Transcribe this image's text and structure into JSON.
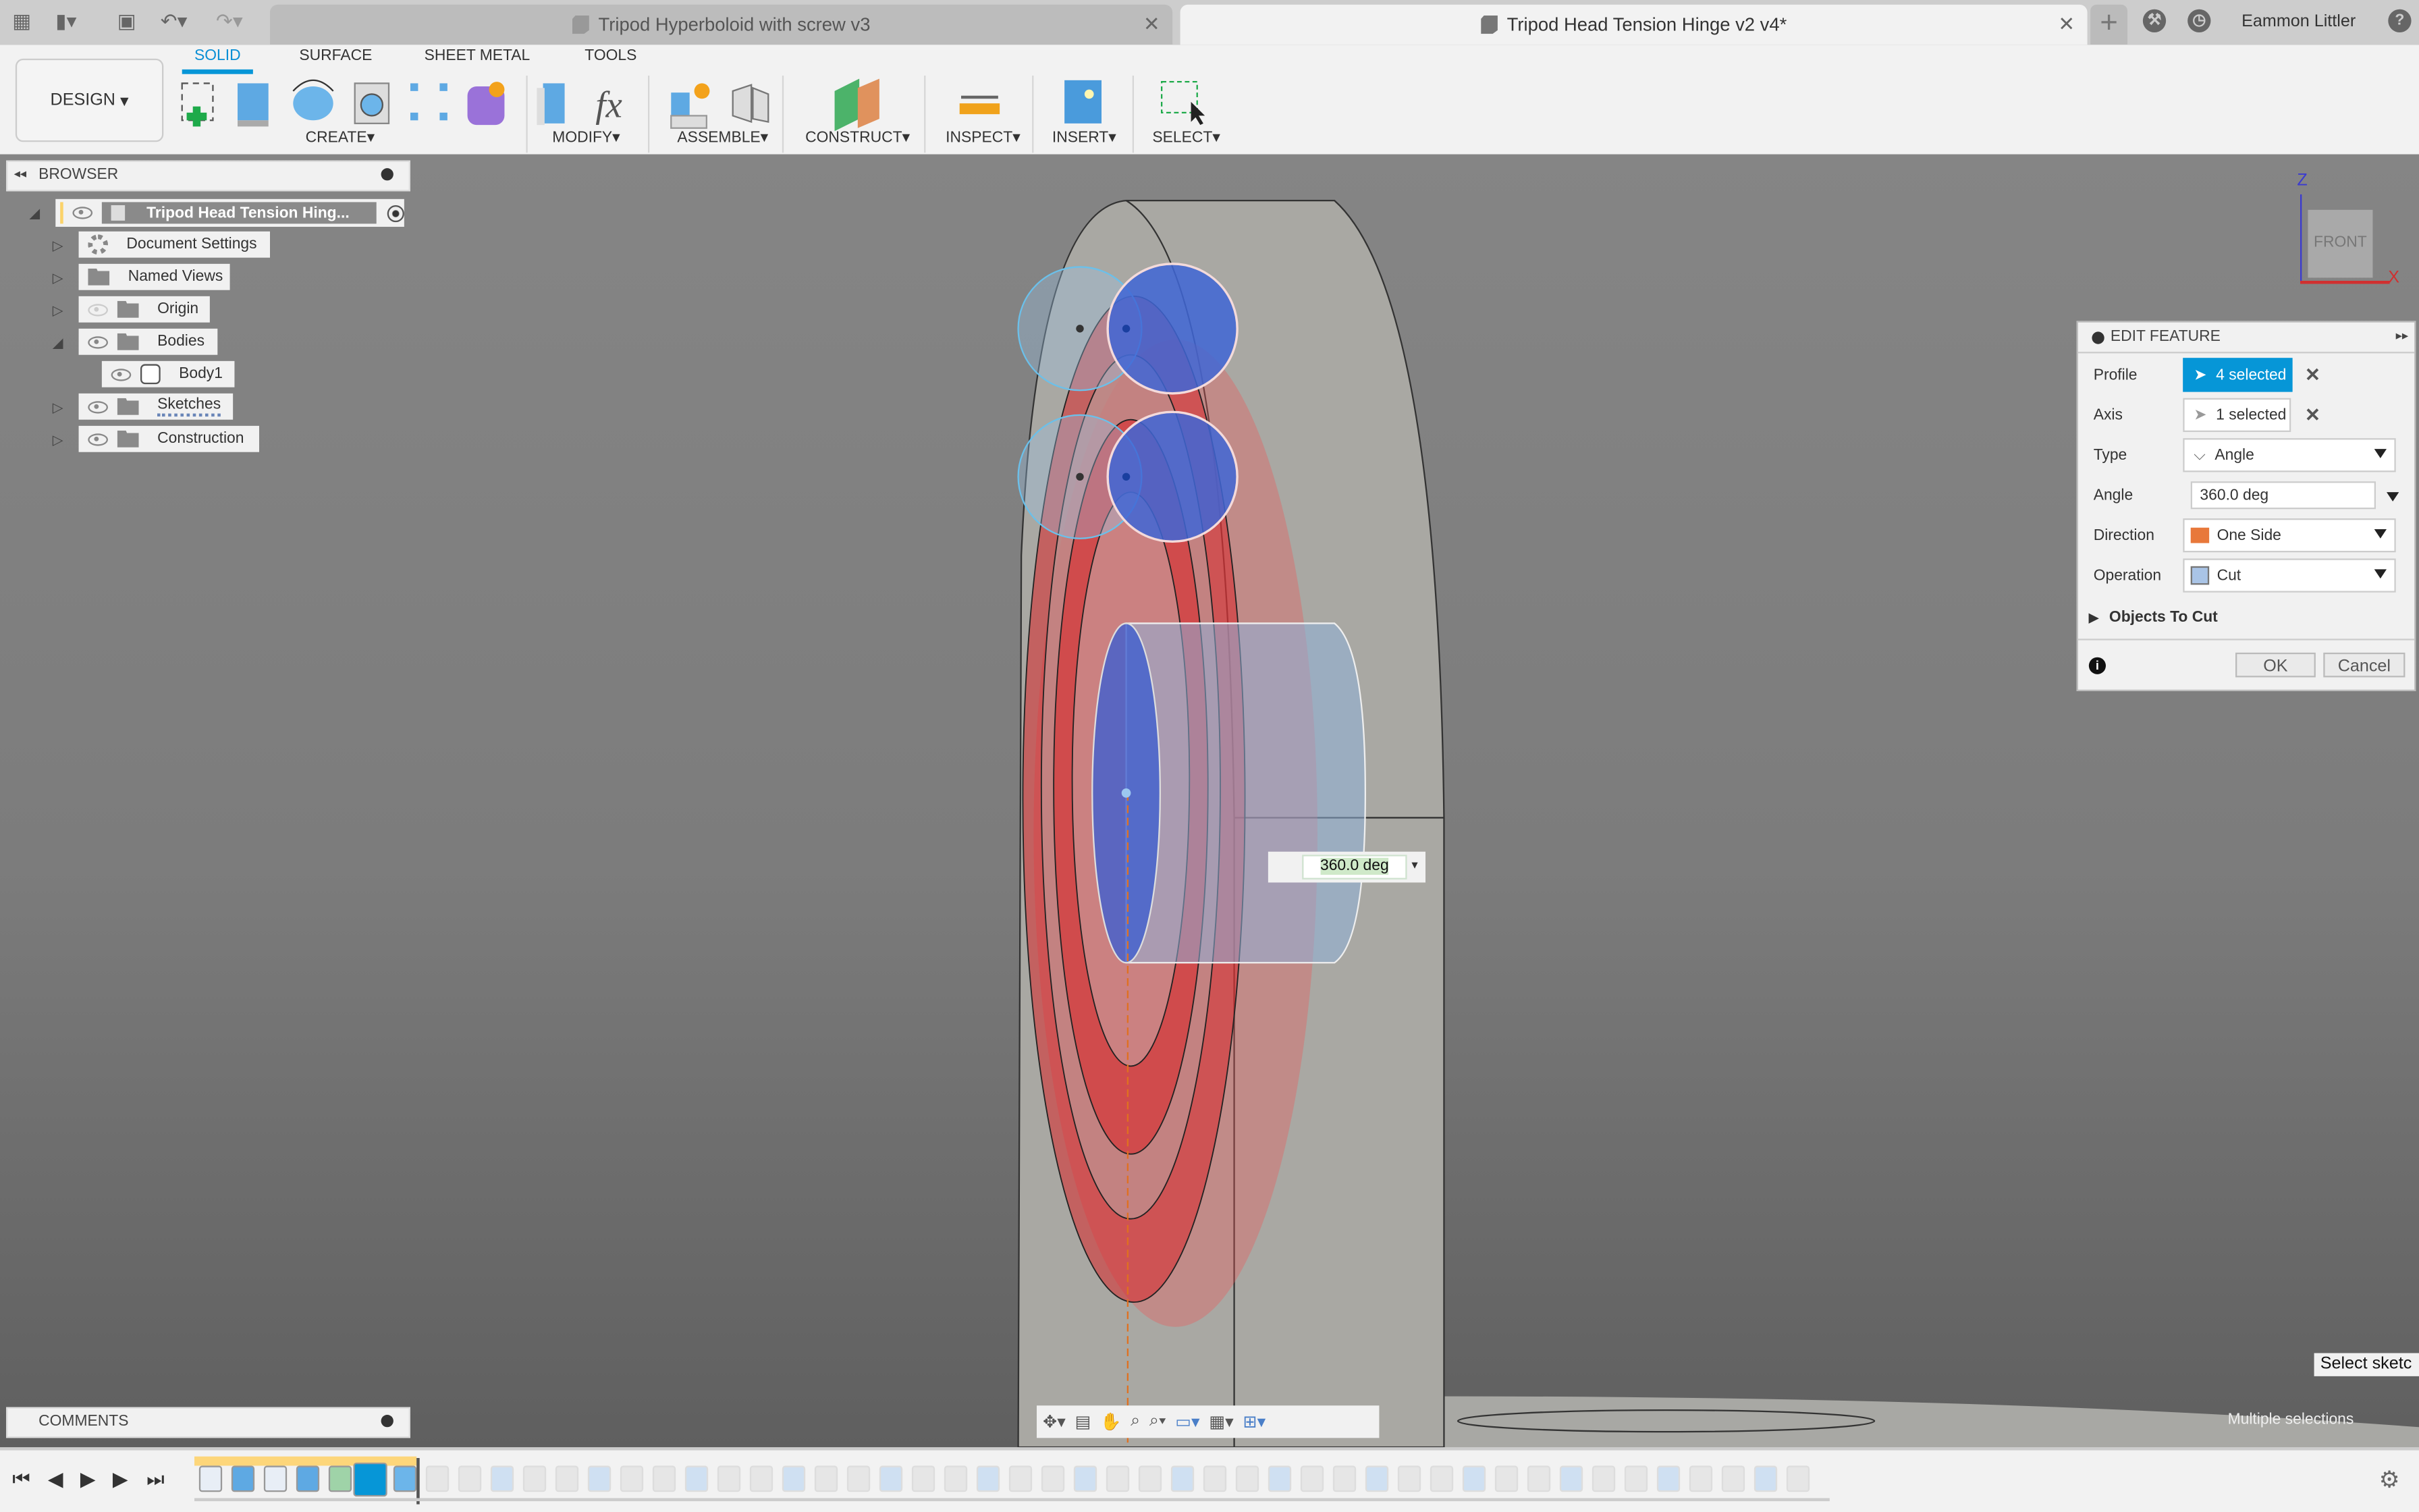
{
  "tabs": [
    {
      "title": "Tripod Hyperboloid with screw v3",
      "active": false
    },
    {
      "title": "Tripod Head Tension Hinge v2 v4*",
      "active": true
    }
  ],
  "user": {
    "name": "Eammon Littler"
  },
  "ribbon": {
    "workspace": "DESIGN",
    "tabs": [
      "SOLID",
      "SURFACE",
      "SHEET METAL",
      "TOOLS"
    ],
    "groups": [
      "CREATE",
      "MODIFY",
      "ASSEMBLE",
      "CONSTRUCT",
      "INSPECT",
      "INSERT",
      "SELECT"
    ]
  },
  "browser": {
    "title": "BROWSER",
    "root": "Tripod Head Tension Hing...",
    "items": [
      {
        "label": "Document Settings"
      },
      {
        "label": "Named Views"
      },
      {
        "label": "Origin"
      },
      {
        "label": "Bodies"
      },
      {
        "label": "Body1"
      },
      {
        "label": "Sketches"
      },
      {
        "label": "Construction"
      }
    ]
  },
  "edit_feature": {
    "title": "EDIT FEATURE",
    "profile_label": "Profile",
    "profile_value": "4 selected",
    "axis_label": "Axis",
    "axis_value": "1 selected",
    "type_label": "Type",
    "type_value": "Angle",
    "angle_label": "Angle",
    "angle_value": "360.0 deg",
    "direction_label": "Direction",
    "direction_value": "One Side",
    "operation_label": "Operation",
    "operation_value": "Cut",
    "objects_to_cut": "Objects To Cut",
    "ok": "OK",
    "cancel": "Cancel"
  },
  "viewport": {
    "angle_input": "360.0 deg",
    "viewcube_face": "FRONT",
    "axis_z": "Z",
    "axis_x": "X",
    "tooltip": "Select sketc",
    "status": "Multiple selections"
  },
  "comments": {
    "title": "COMMENTS"
  },
  "colors": {
    "accent": "#0696d7",
    "profile_blue": "#3f66d6",
    "cut_red": "#e0282a"
  }
}
